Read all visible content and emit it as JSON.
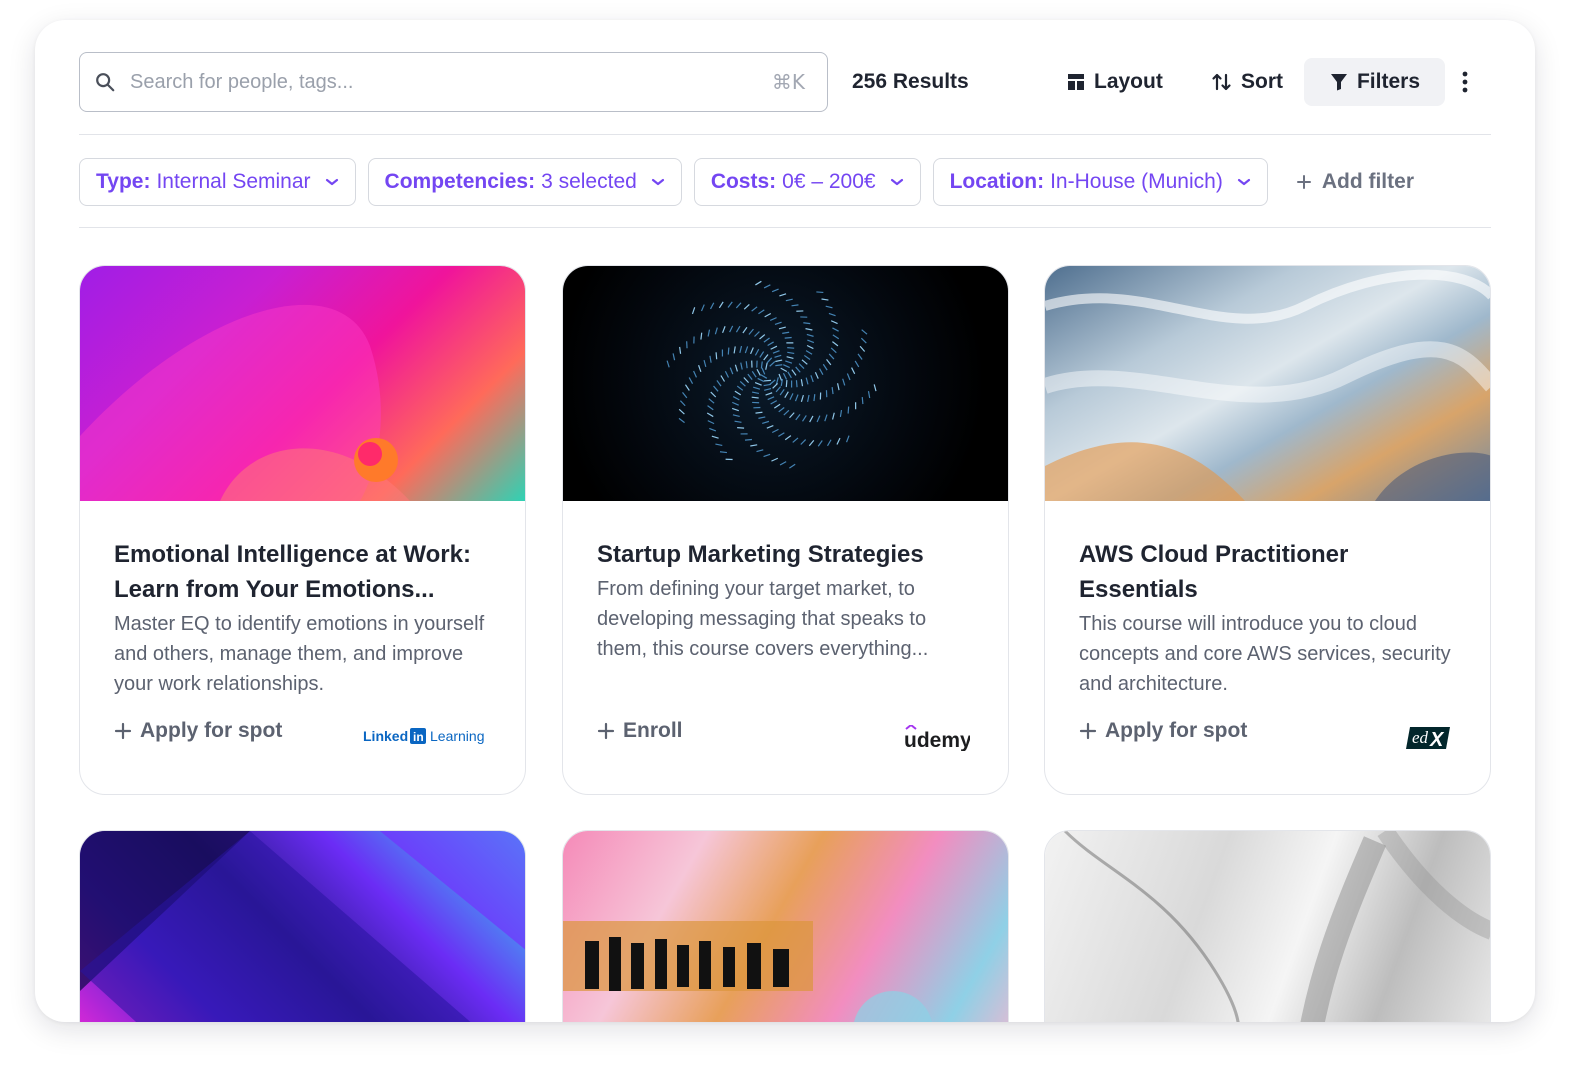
{
  "search": {
    "placeholder": "Search for people, tags...",
    "shortcut": "⌘K"
  },
  "results": "256 Results",
  "toolbar": {
    "layout_label": "Layout",
    "sort_label": "Sort",
    "filters_label": "Filters"
  },
  "filters": [
    {
      "key": "Type:",
      "value": "Internal Seminar"
    },
    {
      "key": "Competencies:",
      "value": "3 selected"
    },
    {
      "key": "Costs:",
      "value": "0€ – 200€"
    },
    {
      "key": "Location:",
      "value": "In-House (Munich)"
    }
  ],
  "add_filter_label": "Add filter",
  "cards": [
    {
      "title": "Emotional Intelligence at Work: Learn from Your Emotions...",
      "description": "Master EQ to identify emotions in yourself and others, manage them, and improve your work relationships.",
      "action": "Apply for spot",
      "provider": "LinkedIn Learning"
    },
    {
      "title": "Startup Marketing Strategies",
      "description": "From defining your target market, to developing messaging that speaks to them, this course covers everything...",
      "action": "Enroll",
      "provider": "Udemy"
    },
    {
      "title": "AWS Cloud Practitioner Essentials",
      "description": "This course will introduce you to cloud concepts and core AWS services, security and architecture.",
      "action": "Apply for spot",
      "provider": "edX"
    }
  ],
  "colors": {
    "accent": "#7446f2",
    "text": "#1f2430",
    "muted": "#5c6270",
    "linkedin_blue": "#0a66c2"
  }
}
